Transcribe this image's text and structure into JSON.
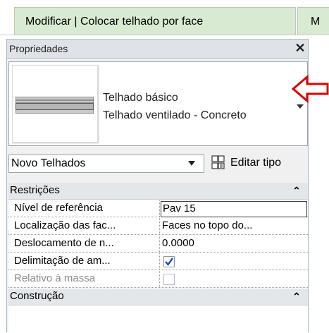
{
  "ribbon": {
    "context_tab": "Modificar | Colocar telhado por face",
    "next_tab_partial": "M"
  },
  "panel": {
    "title": "Propriedades",
    "close_icon": "close-icon",
    "type_selector": {
      "family": "Telhado básico",
      "type": "Telhado ventilado - Concreto"
    },
    "instance_filter": "Novo Telhados",
    "edit_type_label": "Editar tipo",
    "groups": [
      {
        "label": "Restrições",
        "collapse_icon": "collapse-up-icon",
        "properties": [
          {
            "label": "Nível de referência",
            "value": "Pav 15"
          },
          {
            "label": "Localização das fac...",
            "value": "Faces no topo do..."
          },
          {
            "label": "Deslocamento de n...",
            "value": "0.0000"
          },
          {
            "label": "Delimitação de am...",
            "checked": true
          },
          {
            "label": "Relativo à massa",
            "checked": false,
            "disabled": true
          }
        ]
      },
      {
        "label": "Construção",
        "collapse_icon": "collapse-up-icon"
      }
    ]
  },
  "annotation": {
    "arrow_color": "#e00000",
    "arrow_icon": "left-arrow-icon"
  },
  "colors": {
    "context_tab_bg": "#d9ead2",
    "panel_bg": "#f0f0f0",
    "check_mark": "#1f4fa3"
  }
}
